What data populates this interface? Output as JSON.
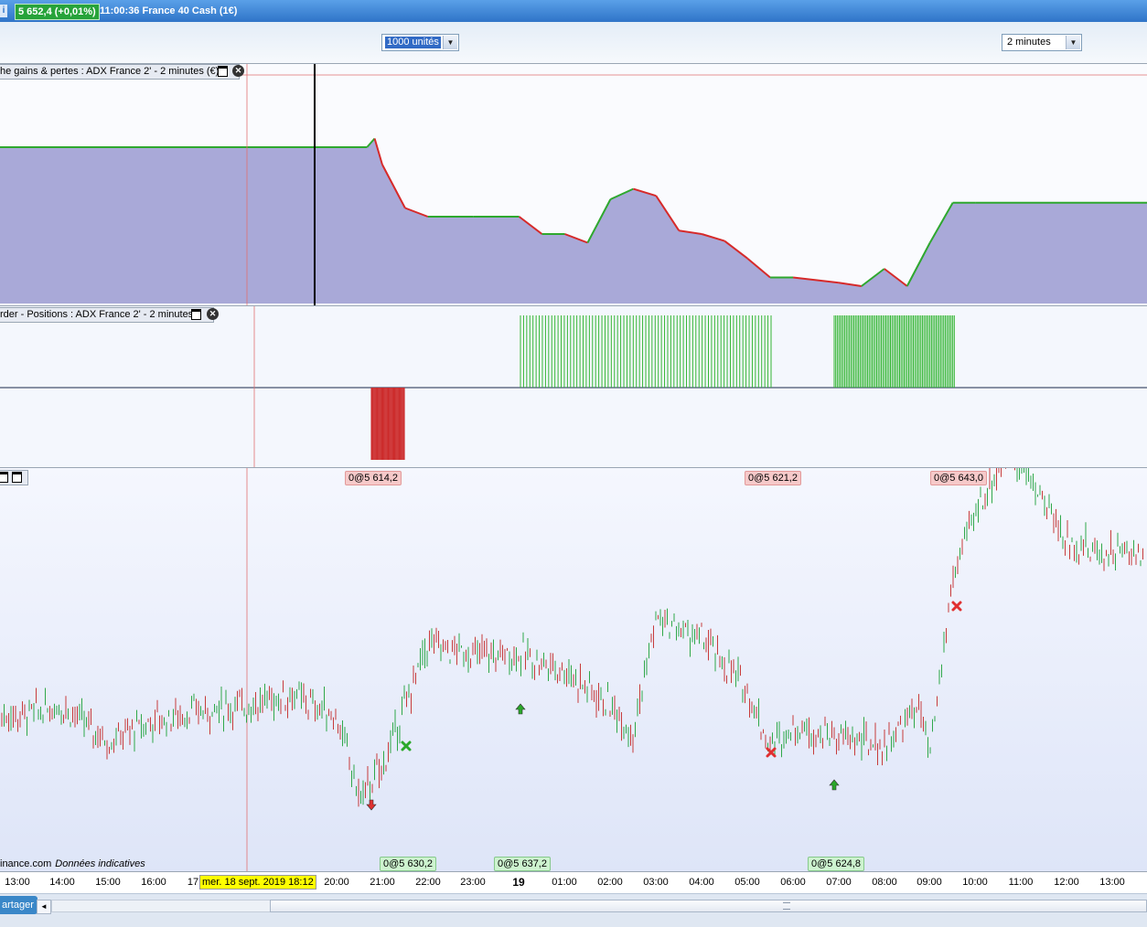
{
  "titlebar": {
    "icon_label": "i",
    "price": "5 652,4 (+0,01%)",
    "title": "11:00:36 France 40 Cash (1€)"
  },
  "toolbar": {
    "units_value": "1000 unités",
    "timeframe_value": "2 minutes"
  },
  "panels": {
    "pnl_label": "he gains & pertes : ADX France 2' - 2 minutes (€)",
    "positions_label": "rder - Positions : ADX France 2' - 2 minutes",
    "price_label": ""
  },
  "orders": {
    "top": [
      "0@5 614,2",
      "0@5 621,2",
      "0@5 643,0"
    ],
    "bottom": [
      "0@5 630,2",
      "0@5 637,2",
      "0@5 624,8"
    ]
  },
  "watermark": {
    "source": "inance.com",
    "note": "Données indicatives"
  },
  "time_axis": {
    "ticks": [
      "13:00",
      "14:00",
      "15:00",
      "16:00",
      "17",
      "20:00",
      "21:00",
      "22:00",
      "23:00",
      "19",
      "01:00",
      "02:00",
      "03:00",
      "04:00",
      "05:00",
      "06:00",
      "07:00",
      "08:00",
      "09:00",
      "10:00",
      "11:00",
      "12:00",
      "13:00"
    ],
    "cursor_date": "mer. 18 sept. 2019 18:12"
  },
  "statusbar": {
    "share_label": "artager",
    "scroll_left_icon": "◄"
  },
  "colors": {
    "gain_line": "#2ea82e",
    "loss_line": "#d62a2a",
    "pnl_fill": "#a9a9d8",
    "position_long": "#34b634",
    "position_short": "#cc2a2a",
    "candle_up": "#2fa84a",
    "candle_down": "#c73b3b"
  },
  "chart_data": [
    {
      "type": "area",
      "title": "",
      "x": [
        "18:12",
        "20:00",
        "20:40",
        "20:50",
        "21:00",
        "21:30",
        "22:00",
        "23:00",
        "00:00",
        "00:30",
        "01:00",
        "01:30",
        "02:00",
        "02:30",
        "03:00",
        "03:30",
        "04:00",
        "04:30",
        "05:00",
        "05:30",
        "06:00",
        "07:00",
        "07:30",
        "08:00",
        "08:30",
        "09:00",
        "09:30",
        "10:00",
        "11:00",
        "13:30"
      ],
      "series": [
        {
          "values": [
            0.9,
            0.9,
            0.9,
            0.95,
            0.8,
            0.55,
            0.5,
            0.5,
            0.5,
            0.4,
            0.4,
            0.35,
            0.6,
            0.66,
            0.62,
            0.42,
            0.4,
            0.36,
            0.26,
            0.15,
            0.15,
            0.12,
            0.1,
            0.2,
            0.1,
            0.35,
            0.58,
            0.58,
            0.58,
            0.58
          ]
        }
      ]
    },
    {
      "type": "bar",
      "title": "",
      "series": [
        {
          "values": [
            1,
            1,
            1,
            1,
            1,
            1,
            1,
            1,
            1,
            1,
            1,
            1,
            1,
            1,
            1,
            1,
            1,
            1,
            1,
            1
          ]
        },
        {
          "values": [
            -1,
            -1,
            -1,
            -1,
            -1,
            -1,
            -1,
            -1,
            -1,
            -1
          ]
        }
      ]
    },
    {
      "type": "line",
      "title": "",
      "x": [
        "13:00",
        "14:00",
        "15:00",
        "16:00",
        "17:00",
        "18:00",
        "19:00",
        "20:00",
        "20:30",
        "21:00",
        "21:30",
        "22:00",
        "23:00",
        "00:00",
        "01:00",
        "02:00",
        "02:30",
        "03:00",
        "04:00",
        "05:00",
        "05:30",
        "06:00",
        "07:00",
        "08:00",
        "08:45",
        "09:00",
        "09:30",
        "10:00",
        "10:45",
        "11:30",
        "12:00",
        "12:40",
        "13:30"
      ],
      "series": [
        {
          "values": [
            5628,
            5630,
            5623,
            5627,
            5629,
            5630,
            5632,
            5628,
            5612,
            5618,
            5630,
            5642,
            5640,
            5640,
            5637,
            5630,
            5625,
            5647,
            5643,
            5633,
            5622,
            5626,
            5624,
            5622,
            5630,
            5620,
            5655,
            5668,
            5680,
            5670,
            5662,
            5660,
            5672
          ]
        }
      ],
      "markers": [
        {
          "label": "0@5 614,2",
          "kind": "sell"
        },
        {
          "label": "0@5 630,2",
          "kind": "exit"
        },
        {
          "label": "0@5 637,2",
          "kind": "buy"
        },
        {
          "label": "0@5 621,2",
          "kind": "exit"
        },
        {
          "label": "0@5 624,8",
          "kind": "buy"
        },
        {
          "label": "0@5 643,0",
          "kind": "exit"
        }
      ]
    }
  ]
}
